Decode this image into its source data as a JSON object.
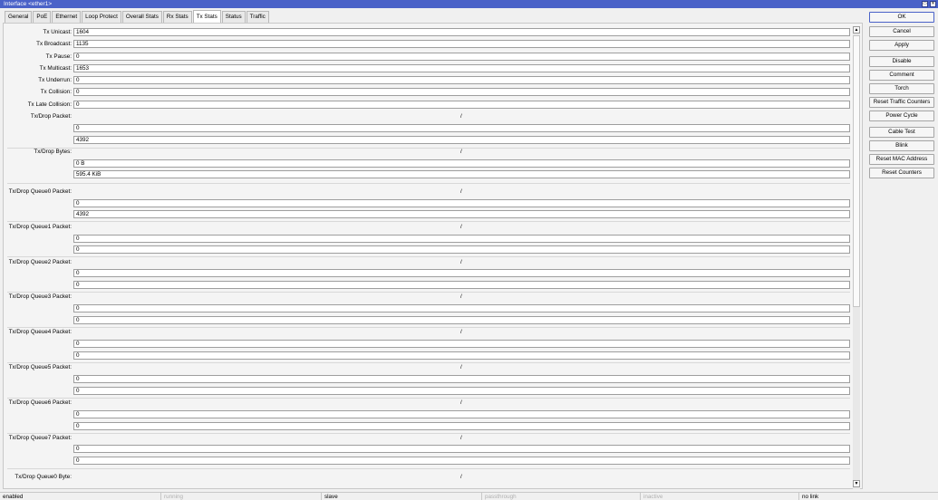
{
  "window": {
    "title": "Interface <ether1>"
  },
  "tabs": [
    {
      "label": "General"
    },
    {
      "label": "PoE"
    },
    {
      "label": "Ethernet"
    },
    {
      "label": "Loop Protect"
    },
    {
      "label": "Overall Stats"
    },
    {
      "label": "Rx Stats"
    },
    {
      "label": "Tx Stats",
      "active": true
    },
    {
      "label": "Status"
    },
    {
      "label": "Traffic"
    }
  ],
  "stats": {
    "tx_unicast": {
      "label": "Tx Unicast:",
      "value": "1604"
    },
    "tx_broadcast": {
      "label": "Tx Broadcast:",
      "value": "1135"
    },
    "tx_pause": {
      "label": "Tx Pause:",
      "value": "0"
    },
    "tx_multicast": {
      "label": "Tx Multicast:",
      "value": "1653"
    },
    "tx_underrun": {
      "label": "Tx Underrun:",
      "value": "0"
    },
    "tx_collision": {
      "label": "Tx Collision:",
      "value": "0"
    },
    "tx_late_collision": {
      "label": "Tx Late Collision:",
      "value": "0"
    }
  },
  "pairs": {
    "separator": "/",
    "tx_drop_packet": {
      "label": "Tx/Drop Packet:",
      "a": "0",
      "b": "4392"
    },
    "tx_drop_bytes": {
      "label": "Tx/Drop Bytes:",
      "a": "0 B",
      "b": "595.4 KiB"
    },
    "q0": {
      "label": "Tx/Drop Queue0 Packet:",
      "a": "0",
      "b": "4392"
    },
    "q1": {
      "label": "Tx/Drop Queue1 Packet:",
      "a": "0",
      "b": "0"
    },
    "q2": {
      "label": "Tx/Drop Queue2 Packet:",
      "a": "0",
      "b": "0"
    },
    "q3": {
      "label": "Tx/Drop Queue3 Packet:",
      "a": "0",
      "b": "0"
    },
    "q4": {
      "label": "Tx/Drop Queue4 Packet:",
      "a": "0",
      "b": "0"
    },
    "q5": {
      "label": "Tx/Drop Queue5 Packet:",
      "a": "0",
      "b": "0"
    },
    "q6": {
      "label": "Tx/Drop Queue6 Packet:",
      "a": "0",
      "b": "0"
    },
    "q7": {
      "label": "Tx/Drop Queue7 Packet:",
      "a": "0",
      "b": "0"
    },
    "q0_byte": {
      "label": "Tx/Drop Queue0 Byte:"
    }
  },
  "buttons": {
    "ok": "OK",
    "cancel": "Cancel",
    "apply": "Apply",
    "disable": "Disable",
    "comment": "Comment",
    "torch": "Torch",
    "reset_traffic": "Reset Traffic Counters",
    "power_cycle": "Power Cycle",
    "cable_test": "Cable Test",
    "blink": "Blink",
    "reset_mac": "Reset MAC Address",
    "reset_counters": "Reset Counters"
  },
  "status": {
    "enabled": "enabled",
    "running": "running",
    "slave": "slave",
    "passthrough": "passthrough",
    "inactive": "inactive",
    "link": "no link"
  },
  "colors": {
    "titlebar": "#4a62c8",
    "background": "#f0f0f0"
  }
}
